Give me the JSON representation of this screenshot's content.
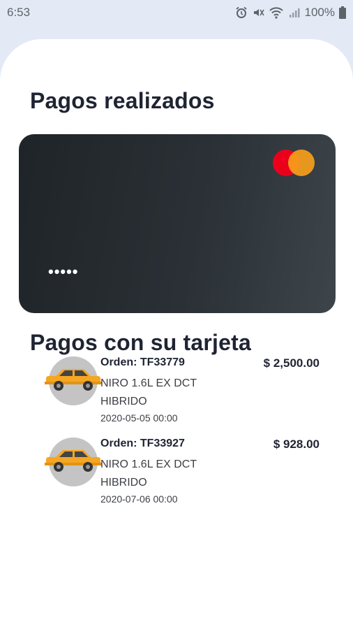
{
  "status_bar": {
    "time": "6:53",
    "battery": "100%",
    "icons": [
      "alarm-icon",
      "mute-icon",
      "wifi-icon",
      "signal-icon",
      "battery-icon"
    ]
  },
  "titles": {
    "completed_payments": "Pagos realizados",
    "card_payments": "Pagos con su tarjeta"
  },
  "card": {
    "masked_number": "•••••",
    "brand": "mastercard"
  },
  "payments": [
    {
      "order": "Orden: TF33779",
      "model": "NIRO 1.6L EX DCT HIBRIDO",
      "date": "2020-05-05 00:00",
      "amount": "$ 2,500.00"
    },
    {
      "order": "Orden: TF33927",
      "model": "NIRO 1.6L EX DCT HIBRIDO",
      "date": "2020-07-06 00:00",
      "amount": "$ 928.00"
    }
  ],
  "colors": {
    "background": "#e4e9f6",
    "card_dark": "#1f2428",
    "mastercard_red": "#eb001b",
    "mastercard_orange": "#f79e1b",
    "car_yellow": "#f5a623"
  }
}
